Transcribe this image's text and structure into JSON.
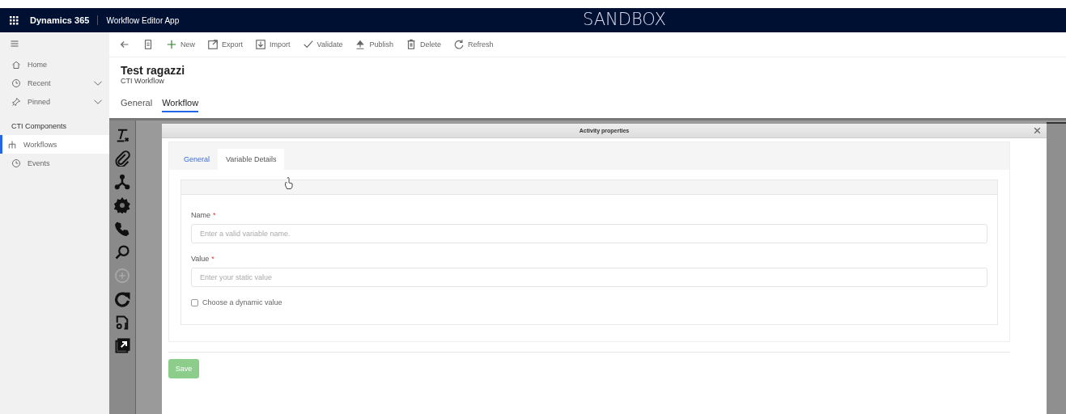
{
  "nav": {
    "app_name": "Dynamics 365",
    "area": "Workflow Editor App",
    "environment": "SANDBOX"
  },
  "command_bar": [
    {
      "kind": "back"
    },
    {
      "kind": "form"
    },
    {
      "kind": "new",
      "label": "New"
    },
    {
      "kind": "export",
      "label": "Export"
    },
    {
      "kind": "import",
      "label": "Import"
    },
    {
      "kind": "validate",
      "label": "Validate"
    },
    {
      "kind": "publish",
      "label": "Publish"
    },
    {
      "kind": "delete",
      "label": "Delete"
    },
    {
      "kind": "refresh",
      "label": "Refresh"
    }
  ],
  "sidebar": {
    "items": [
      {
        "kind": "home",
        "label": "Home",
        "expandable": false
      },
      {
        "kind": "recent",
        "label": "Recent",
        "expandable": true
      },
      {
        "kind": "pinned",
        "label": "Pinned",
        "expandable": true
      }
    ],
    "section": "CTI Components",
    "section_items": [
      {
        "kind": "workflows",
        "label": "Workflows",
        "selected": true
      },
      {
        "kind": "events",
        "label": "Events",
        "selected": false
      }
    ]
  },
  "record": {
    "title": "Test ragazzi",
    "subtitle": "CTI Workflow"
  },
  "tabs": [
    {
      "label": "General",
      "selected": false
    },
    {
      "label": "Workflow",
      "selected": true
    }
  ],
  "toolbox": [
    {
      "kind": "clear-format",
      "disabled": false
    },
    {
      "kind": "attach",
      "disabled": false
    },
    {
      "kind": "branch",
      "disabled": false
    },
    {
      "kind": "gear",
      "disabled": false
    },
    {
      "kind": "phone",
      "disabled": false
    },
    {
      "kind": "search",
      "disabled": false
    },
    {
      "kind": "plus",
      "disabled": true
    },
    {
      "kind": "refresh",
      "disabled": false
    },
    {
      "kind": "doc",
      "disabled": false
    },
    {
      "kind": "external",
      "disabled": false
    }
  ],
  "dialog": {
    "title": "Activity properties",
    "tabs": [
      {
        "label": "General",
        "selected": false
      },
      {
        "label": "Variable Details",
        "selected": true
      }
    ],
    "fields": [
      {
        "label": "Name",
        "required_mark": "*",
        "placeholder": "Enter a valid variable name."
      },
      {
        "label": "Value",
        "required_mark": "*",
        "placeholder": "Enter your static value"
      }
    ],
    "checkbox": {
      "label": "Choose a dynamic value",
      "checked": false
    },
    "save_button": {
      "label": "Save",
      "disabled": true
    }
  }
}
